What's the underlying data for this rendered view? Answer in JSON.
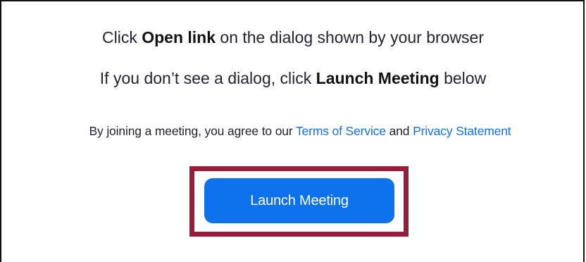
{
  "instructions": {
    "line1": {
      "prefix": "Click ",
      "emphasis": "Open link",
      "suffix": " on the dialog shown by your browser"
    },
    "line2": {
      "prefix": "If you don’t see a dialog, click ",
      "emphasis": "Launch Meeting",
      "suffix": " below"
    }
  },
  "legal": {
    "prefix": "By joining a meeting, you agree to our ",
    "terms_link": "Terms of Service",
    "middle": " and ",
    "privacy_link": "Privacy Statement"
  },
  "launch_button": {
    "label": "Launch Meeting"
  },
  "colors": {
    "link": "#0e72ed",
    "button": "#0e72ed",
    "highlight_border": "#9b1b3a"
  }
}
